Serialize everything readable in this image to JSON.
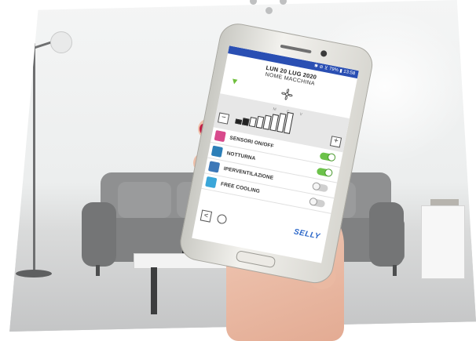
{
  "status_bar": {
    "text": "✱ ⊘ ⊻ 79% ▮ 13:58"
  },
  "app": {
    "date": "LUN 20 LUG 2020",
    "machine_name": "NOME MACCHINA",
    "speed_labels": "M C V",
    "minus_label": "−",
    "plus_label": "+",
    "speed_level": 2,
    "speed_levels_total": 8
  },
  "menu": [
    {
      "label": "SENSORI ON/OFF",
      "icon": "sensor-icon",
      "icon_color": "#d84a8c",
      "toggle": "on"
    },
    {
      "label": "NOTTURNA",
      "icon": "night-icon",
      "icon_color": "#2c7fb8",
      "toggle": "on"
    },
    {
      "label": "IPERVENTILAZIONE",
      "icon": "hyperventilation-icon",
      "icon_color": "#3d78b8",
      "toggle": "off"
    },
    {
      "label": "FREE COOLING",
      "icon": "free-cooling-icon",
      "icon_color": "#3aa6d9",
      "toggle": "off"
    }
  ],
  "bottom": {
    "back_label": "<",
    "brand": "SELLY"
  },
  "colors": {
    "status_bar": "#2a4fb3",
    "toggle_on": "#6cc24a",
    "accent": "#2b67c9",
    "nail": "#c21f45"
  }
}
